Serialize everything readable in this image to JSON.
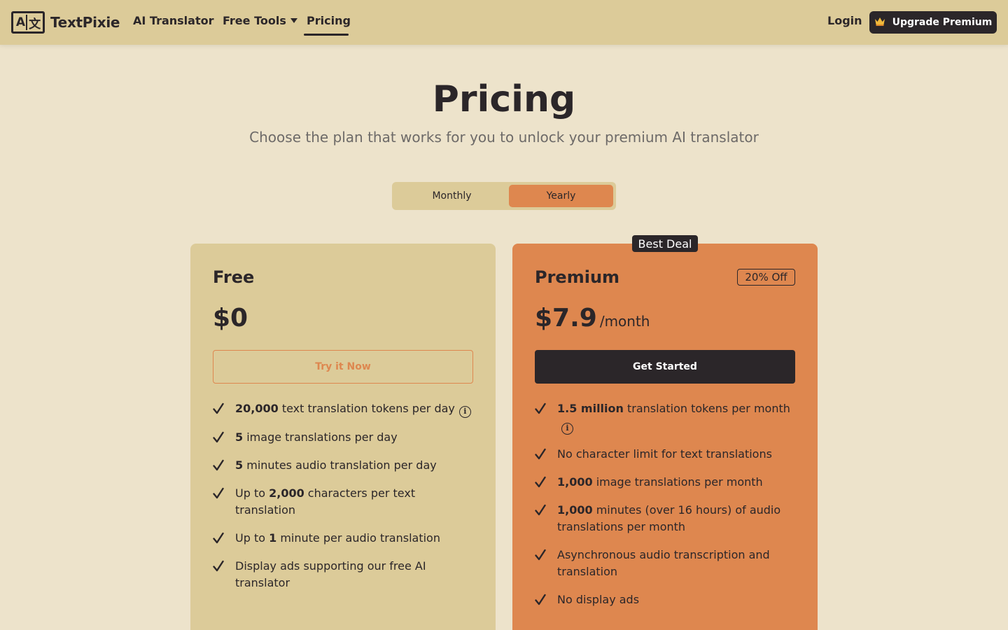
{
  "nav": {
    "logo_mark": "A文",
    "brand": "TextPixie",
    "links": [
      {
        "label": "AI Translator"
      },
      {
        "label": "Free Tools"
      },
      {
        "label": "Pricing"
      }
    ],
    "login": "Login",
    "upgrade": "Upgrade Premium"
  },
  "header": {
    "title": "Pricing",
    "subtitle": "Choose the plan that works for you to unlock your premium AI translator"
  },
  "billing_toggle": {
    "options": [
      "Monthly",
      "Yearly"
    ],
    "selected": "Yearly"
  },
  "plans": {
    "free": {
      "name": "Free",
      "price": "$0",
      "cta": "Try it Now",
      "features": [
        {
          "bold": "20,000",
          "pre": "",
          "text": " text translation tokens per day",
          "info": true
        },
        {
          "bold": "5",
          "pre": "",
          "text": " image translations per day"
        },
        {
          "bold": "5",
          "pre": "",
          "text": " minutes audio translation per day"
        },
        {
          "pre": "Up to ",
          "bold": "2,000",
          "text": " characters per text translation"
        },
        {
          "pre": "Up to ",
          "bold": "1",
          "text": " minute per audio translation"
        },
        {
          "pre": "",
          "bold": "",
          "text": "Display ads supporting our free AI translator"
        }
      ]
    },
    "premium": {
      "name": "Premium",
      "badge": "Best Deal",
      "discount": "20% Off",
      "price": "$7.9",
      "price_unit": "/month",
      "cta": "Get Started",
      "features": [
        {
          "pre": "",
          "bold": "1.5 million",
          "text": " translation tokens per month",
          "info": true
        },
        {
          "pre": "",
          "bold": "",
          "text": "No character limit for text translations"
        },
        {
          "pre": "",
          "bold": "1,000",
          "text": " image translations per month"
        },
        {
          "pre": "",
          "bold": "1,000",
          "text": " minutes (over 16 hours) of audio translations per month"
        },
        {
          "pre": "",
          "bold": "",
          "text": "Asynchronous audio transcription and translation"
        },
        {
          "pre": "",
          "bold": "",
          "text": "No display ads"
        }
      ]
    }
  },
  "colors": {
    "nav_bg": "#dccb99",
    "page_bg": "#ede3cb",
    "accent": "#de874f",
    "dark": "#2b2629"
  }
}
